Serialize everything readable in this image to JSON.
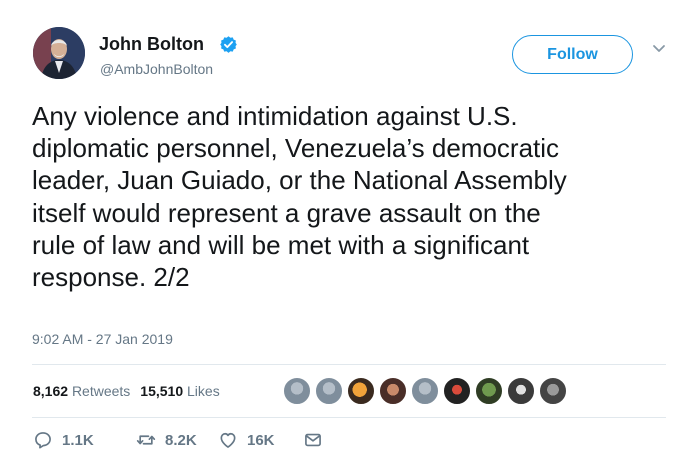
{
  "header": {
    "name": "John Bolton",
    "handle": "@AmbJohnBolton",
    "follow_label": "Follow"
  },
  "tweet": {
    "lines": [
      "Any violence and intimidation against U.S.",
      "diplomatic personnel, Venezuela’s democratic",
      "leader, Juan Guiado, or the National Assembly",
      "itself would represent a grave assault on the",
      "rule of law and will be met with a significant",
      "response. 2/2"
    ],
    "timestamp": "9:02 AM - 27 Jan 2019"
  },
  "stats": {
    "retweets_count": "8,162",
    "retweets_label": "Retweets",
    "likes_count": "15,510",
    "likes_label": "Likes"
  },
  "actions": {
    "reply_count": "1.1K",
    "retweet_count": "8.2K",
    "like_count": "16K"
  },
  "icons": {
    "verified": "verified-badge-icon",
    "caret": "chevron-down-icon",
    "reply": "reply-icon",
    "retweet": "retweet-icon",
    "like": "heart-icon",
    "dm": "envelope-icon"
  },
  "colors": {
    "accent": "#1b95e0",
    "text": "#14171a",
    "muted": "#657786",
    "divider": "#e1e8ed"
  }
}
